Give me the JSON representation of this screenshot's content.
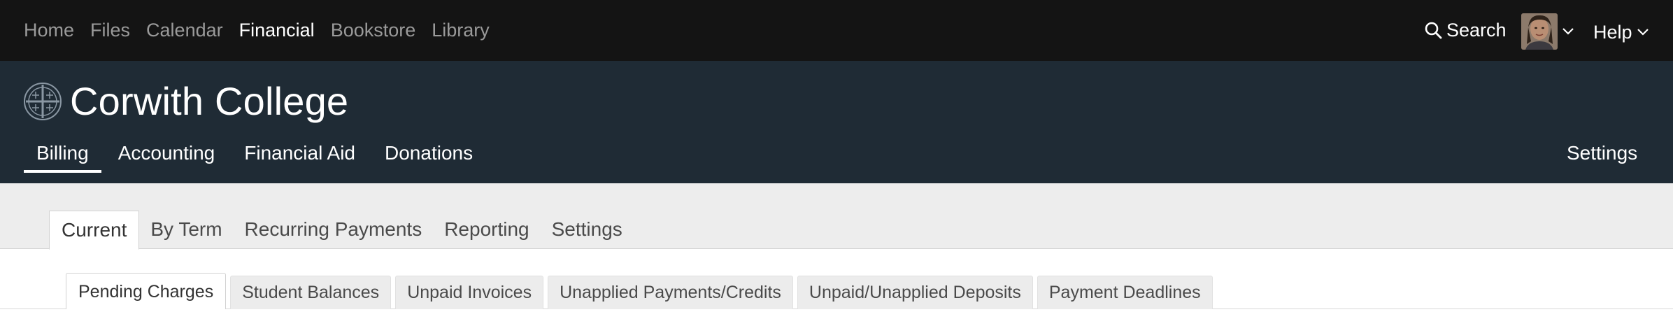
{
  "topnav": {
    "items": [
      {
        "label": "Home",
        "active": false
      },
      {
        "label": "Files",
        "active": false
      },
      {
        "label": "Calendar",
        "active": false
      },
      {
        "label": "Financial",
        "active": true
      },
      {
        "label": "Bookstore",
        "active": false
      },
      {
        "label": "Library",
        "active": false
      }
    ],
    "search_label": "Search",
    "help_label": "Help",
    "search_icon": "search-icon",
    "user_avatar": "avatar",
    "colors": {
      "bar": "#141414",
      "inactive": "#9a9a9a",
      "active": "#ffffff"
    }
  },
  "header": {
    "college_name": "Corwith College",
    "seal_icon": "college-seal-icon",
    "settings_label": "Settings",
    "colors": {
      "band": "#1f2b35"
    },
    "nav": [
      {
        "label": "Billing",
        "active": true
      },
      {
        "label": "Accounting",
        "active": false
      },
      {
        "label": "Financial Aid",
        "active": false
      },
      {
        "label": "Donations",
        "active": false
      }
    ]
  },
  "billing_tabs": [
    {
      "label": "Current",
      "active": true
    },
    {
      "label": "By Term",
      "active": false
    },
    {
      "label": "Recurring Payments",
      "active": false
    },
    {
      "label": "Reporting",
      "active": false
    },
    {
      "label": "Settings",
      "active": false
    }
  ],
  "current_tabs": [
    {
      "label": "Pending Charges",
      "active": true
    },
    {
      "label": "Student Balances",
      "active": false
    },
    {
      "label": "Unpaid Invoices",
      "active": false
    },
    {
      "label": "Unapplied Payments/Credits",
      "active": false
    },
    {
      "label": "Unpaid/Unapplied Deposits",
      "active": false
    },
    {
      "label": "Payment Deadlines",
      "active": false
    }
  ]
}
